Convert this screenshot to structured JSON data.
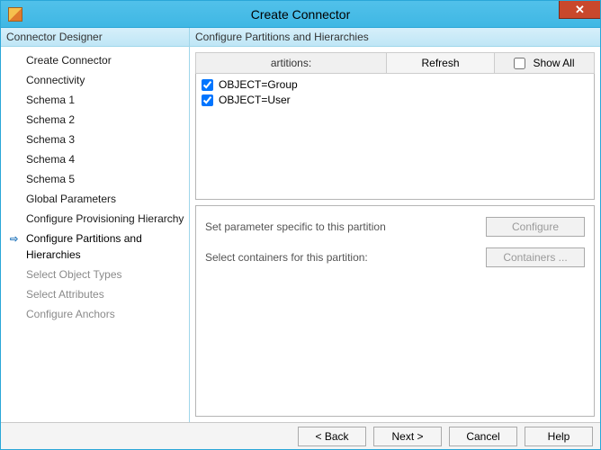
{
  "window": {
    "title": "Create Connector",
    "close_glyph": "✕"
  },
  "sidebar": {
    "header": "Connector Designer",
    "items": [
      {
        "label": "Create Connector",
        "state": "normal"
      },
      {
        "label": "Connectivity",
        "state": "normal"
      },
      {
        "label": "Schema 1",
        "state": "normal"
      },
      {
        "label": "Schema 2",
        "state": "normal"
      },
      {
        "label": "Schema 3",
        "state": "normal"
      },
      {
        "label": "Schema 4",
        "state": "normal"
      },
      {
        "label": "Schema 5",
        "state": "normal"
      },
      {
        "label": "Global Parameters",
        "state": "normal"
      },
      {
        "label": "Configure Provisioning Hierarchy",
        "state": "normal"
      },
      {
        "label": "Configure Partitions and Hierarchies",
        "state": "current"
      },
      {
        "label": "Select Object Types",
        "state": "disabled"
      },
      {
        "label": "Select Attributes",
        "state": "disabled"
      },
      {
        "label": "Configure Anchors",
        "state": "disabled"
      }
    ]
  },
  "content": {
    "header": "Configure Partitions and Hierarchies",
    "toolbar": {
      "partitions_label": "artitions:",
      "refresh": "Refresh",
      "show_all": "Show All",
      "show_all_checked": false
    },
    "partitions": [
      {
        "label": "OBJECT=Group",
        "checked": true
      },
      {
        "label": "OBJECT=User",
        "checked": true
      }
    ],
    "lower": {
      "param_text": "Set parameter specific to this partition",
      "configure_btn": "Configure",
      "configure_enabled": false,
      "containers_text": "Select containers for this partition:",
      "containers_btn": "Containers ...",
      "containers_enabled": false
    }
  },
  "footer": {
    "back": "<  Back",
    "next": "Next  >",
    "cancel": "Cancel",
    "help": "Help"
  }
}
